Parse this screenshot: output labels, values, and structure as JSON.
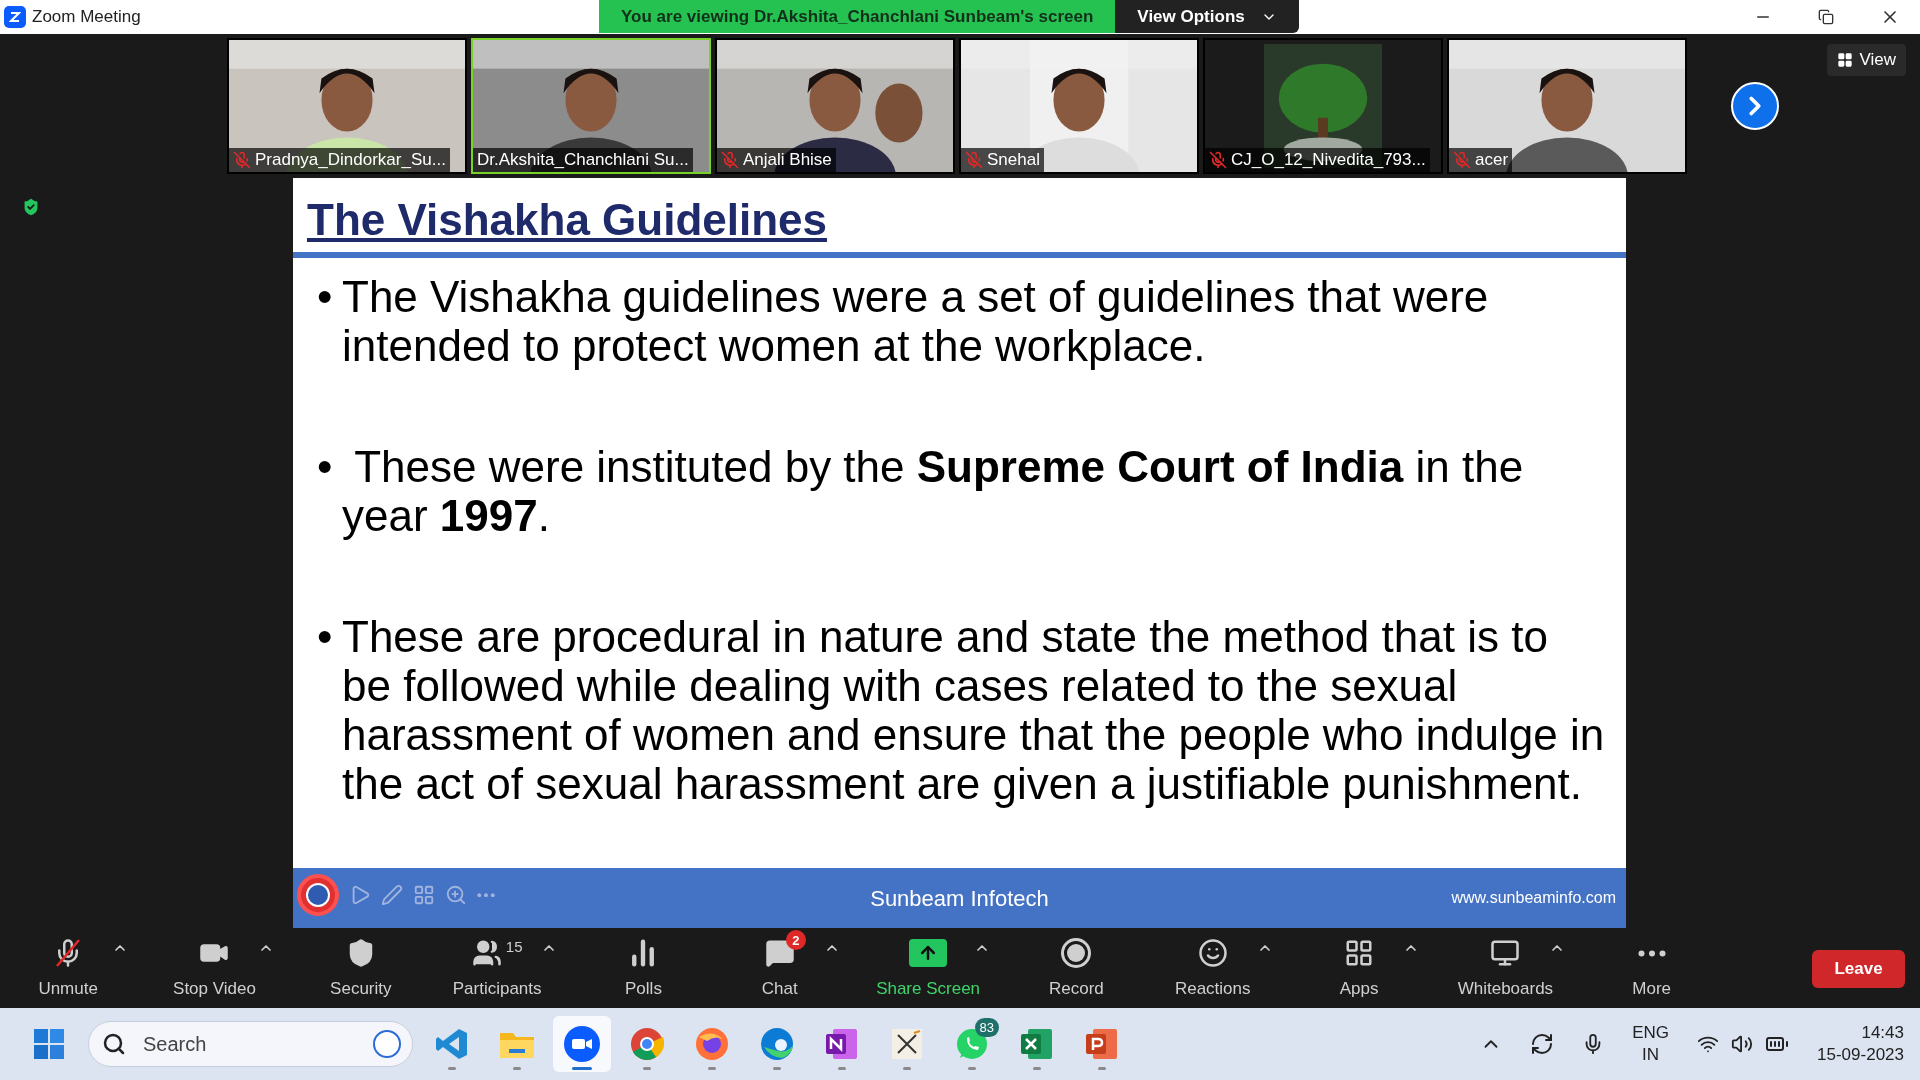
{
  "window": {
    "title": "Zoom Meeting"
  },
  "banner": {
    "text": "You are viewing Dr.Akshita_Chanchlani Sunbeam's screen",
    "button": "View Options"
  },
  "participants": [
    {
      "name": "Pradnya_Dindorkar_Su...",
      "muted": true,
      "selected": false
    },
    {
      "name": "Dr.Akshita_Chanchlani Su...",
      "muted": false,
      "selected": true
    },
    {
      "name": "Anjali Bhise",
      "muted": true,
      "selected": false
    },
    {
      "name": "Snehal",
      "muted": true,
      "selected": false
    },
    {
      "name": "CJ_O_12_Nivedita_793...",
      "muted": true,
      "selected": false
    },
    {
      "name": "acer",
      "muted": true,
      "selected": false
    }
  ],
  "view_button": "View",
  "slide": {
    "title": "The Vishakha Guidelines",
    "bullets": [
      {
        "marker": "•",
        "text": "The Vishakha guidelines were a set of guidelines that were intended to protect women at the workplace."
      },
      {
        "marker": "•",
        "text": " These were instituted by the **Supreme Court of India** in the year **1997**."
      },
      {
        "marker": "•",
        "text": "These are procedural in nature and state the method that is to be followed while dealing with cases related to the sexual harassment of women and ensure that the people who indulge in the act of sexual harassment are given a justifiable punishment."
      }
    ],
    "footer_center": "Sunbeam Infotech",
    "footer_url": "www.sunbeaminfo.com"
  },
  "toolbar": [
    {
      "kind": "mic-muted",
      "label": "Unmute",
      "caret": true
    },
    {
      "kind": "video",
      "label": "Stop Video",
      "caret": true
    },
    {
      "kind": "security",
      "label": "Security",
      "caret": false
    },
    {
      "kind": "participants",
      "label": "Participants",
      "count": "15",
      "caret": true
    },
    {
      "kind": "polls",
      "label": "Polls",
      "caret": false
    },
    {
      "kind": "chat",
      "label": "Chat",
      "badge": "2",
      "caret": true
    },
    {
      "kind": "share",
      "label": "Share Screen",
      "caret": true,
      "highlighted": true
    },
    {
      "kind": "record",
      "label": "Record",
      "caret": false
    },
    {
      "kind": "reactions",
      "label": "Reactions",
      "caret": true
    },
    {
      "kind": "apps",
      "label": "Apps",
      "caret": true
    },
    {
      "kind": "whiteboards",
      "label": "Whiteboards",
      "caret": true
    },
    {
      "kind": "more",
      "label": "More",
      "caret": false
    }
  ],
  "leave_button": "Leave",
  "taskbar": {
    "search_placeholder": "Search",
    "apps": [
      {
        "kind": "vscode",
        "selected": false
      },
      {
        "kind": "files",
        "selected": false
      },
      {
        "kind": "zoom",
        "selected": true
      },
      {
        "kind": "chrome",
        "selected": false
      },
      {
        "kind": "firefox",
        "selected": false
      },
      {
        "kind": "edge",
        "selected": false
      },
      {
        "kind": "onenote",
        "selected": false
      },
      {
        "kind": "math",
        "selected": false
      },
      {
        "kind": "whatsapp",
        "badge": "83",
        "selected": false
      },
      {
        "kind": "excel",
        "selected": false
      },
      {
        "kind": "powerpoint",
        "selected": false
      }
    ],
    "language": "ENG",
    "region": "IN",
    "time": "14:43",
    "date": "15-09-2023"
  }
}
